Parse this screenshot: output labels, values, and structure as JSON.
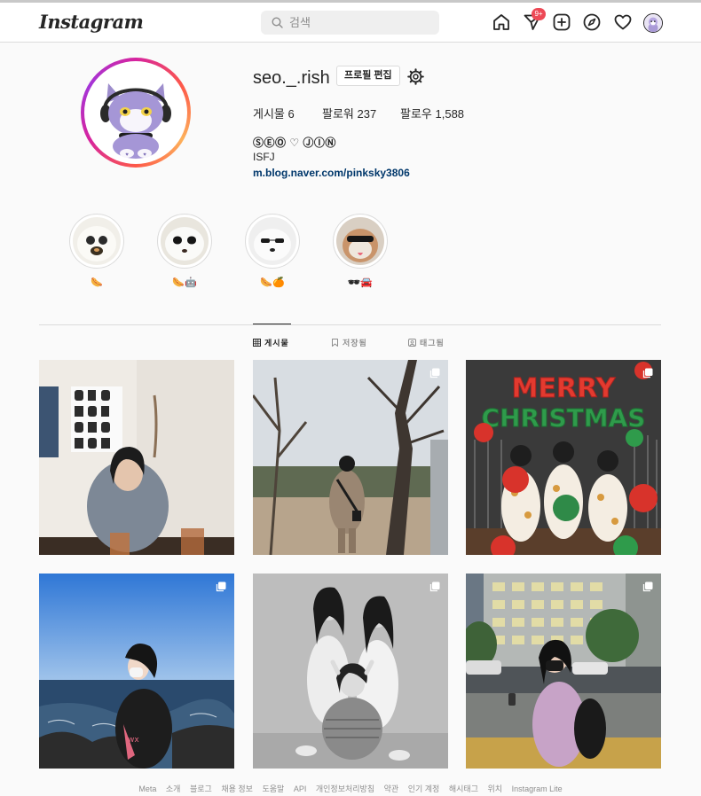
{
  "header": {
    "logo": "Instagram",
    "search_placeholder": "검색",
    "notification_badge": "9+",
    "icons": [
      "home-icon",
      "direct-icon",
      "new-post-icon",
      "explore-icon",
      "activity-icon",
      "avatar"
    ]
  },
  "profile": {
    "username": "seo._.rish",
    "edit_button": "프로필 편집",
    "stats": {
      "posts": "게시물 6",
      "followers": "팔로워 237",
      "following": "팔로우 1,588"
    },
    "display_name": "ⓈⒺⓄ ♡ ⒿⒾⓃ",
    "bio": "ISFJ",
    "link": "m.blog.naver.com/pinksky3806"
  },
  "highlights": [
    {
      "label": "🌭"
    },
    {
      "label": "🌭🤖"
    },
    {
      "label": "🌭🍊"
    },
    {
      "label": "🕶🚘"
    }
  ],
  "tabs": [
    {
      "label": "게시물",
      "active": true
    },
    {
      "label": "저장됨",
      "active": false
    },
    {
      "label": "태그됨",
      "active": false
    }
  ],
  "posts": [
    {
      "multi": false
    },
    {
      "multi": true
    },
    {
      "multi": true
    },
    {
      "multi": true
    },
    {
      "multi": true
    },
    {
      "multi": true
    }
  ],
  "footer": {
    "links": [
      "Meta",
      "소개",
      "블로그",
      "채용 정보",
      "도움말",
      "API",
      "개인정보처리방침",
      "약관",
      "인기 계정",
      "해시태그",
      "위치",
      "Instagram Lite"
    ]
  },
  "colors": {
    "link": "#00376b",
    "badge": "#ed4956",
    "border": "#dbdbdb",
    "muted": "#8e8e8e"
  }
}
